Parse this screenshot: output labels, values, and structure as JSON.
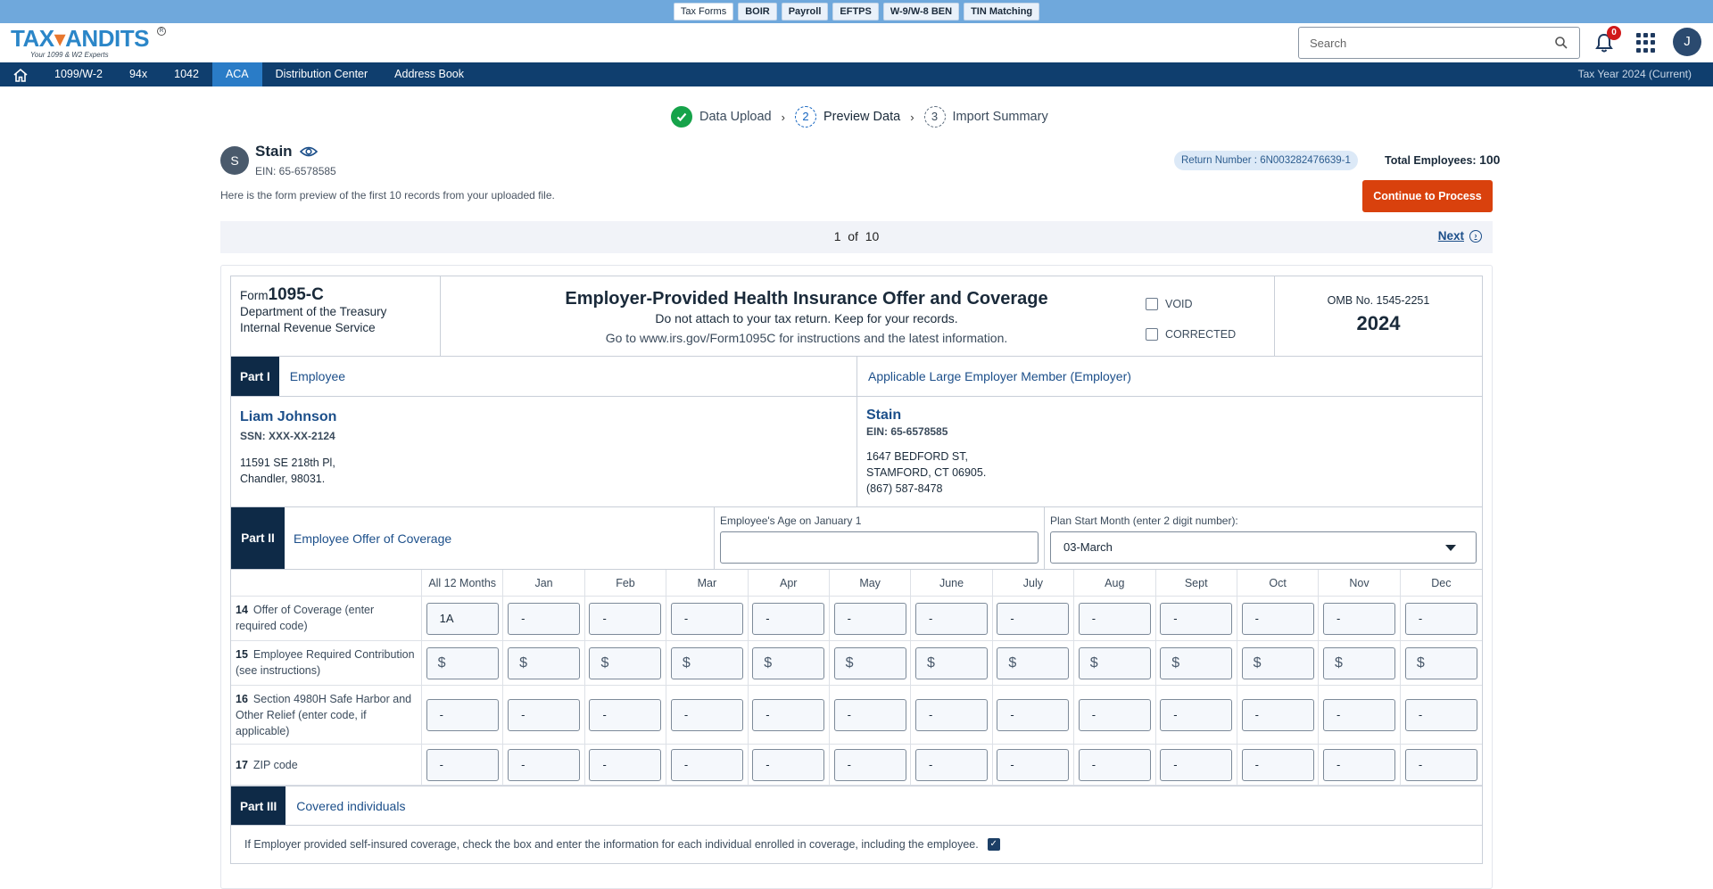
{
  "topbar": {
    "tabs": [
      "Tax Forms",
      "BOIR",
      "Payroll",
      "EFTPS",
      "W-9/W-8 BEN",
      "TIN Matching"
    ]
  },
  "header": {
    "logo_text_a": "TAX",
    "logo_text_b": "ANDITS",
    "logo_tagline": "Your 1099 & W2 Experts",
    "search_placeholder": "Search",
    "notification_count": "0",
    "user_initial": "J"
  },
  "nav": {
    "items": [
      "1099/W-2",
      "94x",
      "1042",
      "ACA",
      "Distribution Center",
      "Address Book"
    ],
    "active": "ACA",
    "tax_year": "Tax Year 2024 (Current)"
  },
  "stepper": {
    "steps": [
      {
        "num": "1",
        "label": "Data Upload",
        "state": "done"
      },
      {
        "num": "2",
        "label": "Preview Data",
        "state": "current"
      },
      {
        "num": "3",
        "label": "Import Summary",
        "state": "pending"
      }
    ]
  },
  "employer": {
    "initial": "S",
    "name": "Stain",
    "ein": "EIN: 65-6578585",
    "preview_note": "Here is the form preview of the first 10 records from your uploaded file.",
    "return_number": "Return Number : 6N003282476639-1",
    "total_employees_label": "Total Employees:",
    "total_employees": "100",
    "continue_label": "Continue to Process"
  },
  "pager": {
    "current": "1",
    "of": "of",
    "total": "10",
    "next_label": "Next"
  },
  "form": {
    "form_prefix": "Form",
    "form_number": "1095-C",
    "dept": "Department of the Treasury",
    "irs": "Internal Revenue Service",
    "title": "Employer-Provided Health Insurance Offer and Coverage",
    "subtitle": "Do not attach to your tax return. Keep for your records.",
    "instructions": "Go to www.irs.gov/Form1095C for instructions and the latest information.",
    "void_label": "VOID",
    "corrected_label": "CORRECTED",
    "omb": "OMB No. 1545-2251",
    "year": "2024",
    "part1_tag": "Part I",
    "part1_title": "Employee",
    "employer_section_title": "Applicable Large Employer Member (Employer)",
    "employee": {
      "name": "Liam Johnson",
      "ssn": "SSN: XXX-XX-2124",
      "address1": "11591 SE 218th Pl,",
      "address2": "Chandler, 98031."
    },
    "employer_box": {
      "name": "Stain",
      "ein": "EIN: 65-6578585",
      "address1": "1647 BEDFORD ST,",
      "address2": "STAMFORD, CT 06905.",
      "phone": "(867) 587-8478"
    },
    "part2_tag": "Part II",
    "part2_title": "Employee Offer of Coverage",
    "age_label": "Employee's Age on January 1",
    "age_value": "",
    "plan_label": "Plan Start Month (enter 2 digit number):",
    "plan_value": "03-March",
    "months": [
      "All 12 Months",
      "Jan",
      "Feb",
      "Mar",
      "Apr",
      "May",
      "June",
      "July",
      "Aug",
      "Sept",
      "Oct",
      "Nov",
      "Dec"
    ],
    "rows": [
      {
        "num": "14",
        "label": "Offer of Coverage (enter required code)",
        "values": [
          "1A",
          "-",
          "-",
          "-",
          "-",
          "-",
          "-",
          "-",
          "-",
          "-",
          "-",
          "-",
          "-"
        ]
      },
      {
        "num": "15",
        "label": "Employee Required Contribution (see instructions)",
        "values": [
          "$",
          "$",
          "$",
          "$",
          "$",
          "$",
          "$",
          "$",
          "$",
          "$",
          "$",
          "$",
          "$"
        ]
      },
      {
        "num": "16",
        "label": "Section 4980H Safe Harbor and Other Relief (enter code, if applicable)",
        "values": [
          "-",
          "-",
          "-",
          "-",
          "-",
          "-",
          "-",
          "-",
          "-",
          "-",
          "-",
          "-",
          "-"
        ]
      },
      {
        "num": "17",
        "label": "ZIP code",
        "values": [
          "-",
          "-",
          "-",
          "-",
          "-",
          "-",
          "-",
          "-",
          "-",
          "-",
          "-",
          "-",
          "-"
        ]
      }
    ],
    "part3_tag": "Part III",
    "part3_title": "Covered individuals",
    "part3_note": "If Employer provided self-insured coverage, check the box and enter the information for each individual enrolled in coverage, including the employee."
  }
}
